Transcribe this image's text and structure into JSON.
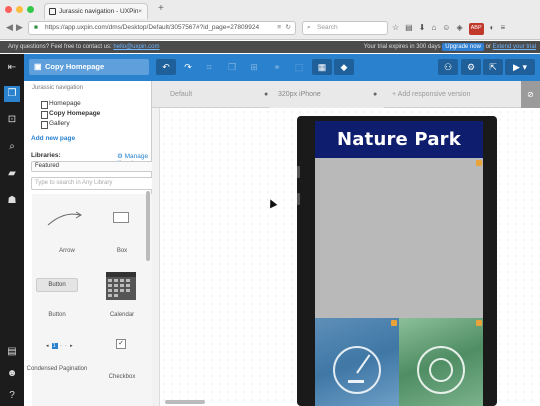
{
  "browser": {
    "tab_title": "Jurassic navigation - UXPin",
    "tab_close": "×",
    "new_tab": "+",
    "url": "https://app.uxpin.com/dms/Desktop/Default/3057567#?id_page=27809924",
    "search_placeholder": "Search"
  },
  "trial_bar": {
    "question": "Any questions? Feel free to contact us: ",
    "email": "hello@uxpin.com",
    "expires": "Your trial expires in 300 days",
    "upgrade": "Upgrade now",
    "or": "or",
    "extend": "Extend your trial"
  },
  "toolbar": {
    "page_select": "Copy Homepage"
  },
  "panel": {
    "project_name": "Jurassic navigation",
    "pages": [
      "Homepage",
      "Copy Homepage",
      "Gallery"
    ],
    "add_page": "Add new page",
    "libraries_label": "Libraries:",
    "manage_libraries": "Manage libraries",
    "library_selected": "Featured",
    "library_search_placeholder": "Type to search in Any Library",
    "elements": [
      "Arrow",
      "Box",
      "Button",
      "Calendar",
      "Condensed Pagination",
      "Checkbox"
    ],
    "button_sample": "Button"
  },
  "canvas": {
    "default_tab": "Default",
    "device_tab": "320px iPhone",
    "add_responsive": "+ Add responsive version",
    "hero_title": "Nature Park"
  },
  "colors": {
    "brand_blue": "#2a82cf",
    "hero_navy": "#0f1d6e",
    "dark_nav": "#1c1c1c"
  }
}
